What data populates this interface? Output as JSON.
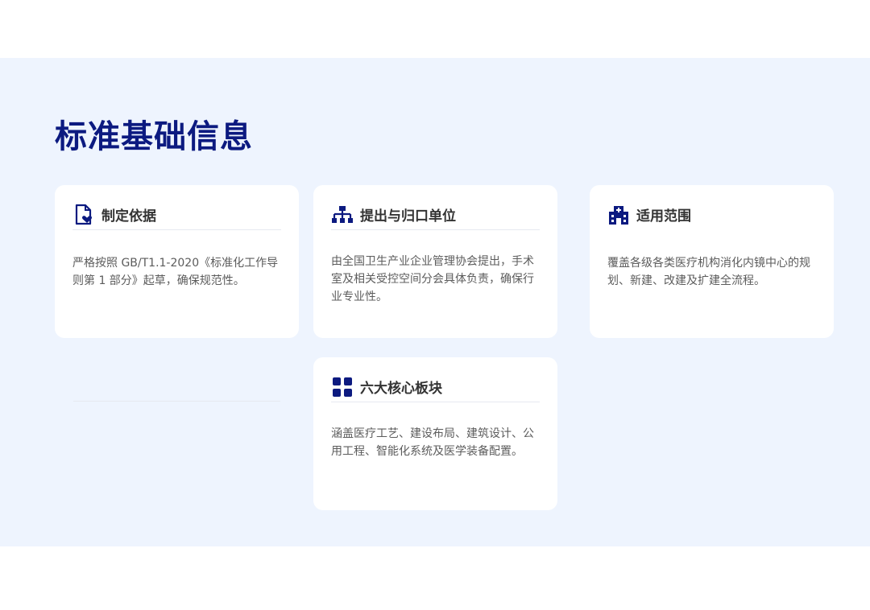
{
  "page": {
    "title": "标准基础信息"
  },
  "cards": [
    {
      "icon": "document-heart-icon",
      "title": "制定依据",
      "body": "严格按照 GB/T1.1-2020《标准化工作导则第 1 部分》起草，确保规范性。"
    },
    {
      "icon": "org-chart-icon",
      "title": "提出与归口单位",
      "body": "由全国卫生产业企业管理协会提出，手术室及相关受控空间分会具体负责，确保行业专业性。"
    },
    {
      "icon": "hospital-icon",
      "title": "适用范围",
      "body": "覆盖各级各类医疗机构消化内镜中心的规划、新建、改建及扩建全流程。"
    },
    {
      "icon": "grid-blocks-icon",
      "title": "六大核心板块",
      "body": "涵盖医疗工艺、建设布局、建筑设计、公用工程、智能化系统及医学装备配置。"
    }
  ],
  "colors": {
    "accent": "#0c1a80",
    "band_background": "#eef4fe",
    "card_background": "#ffffff"
  }
}
